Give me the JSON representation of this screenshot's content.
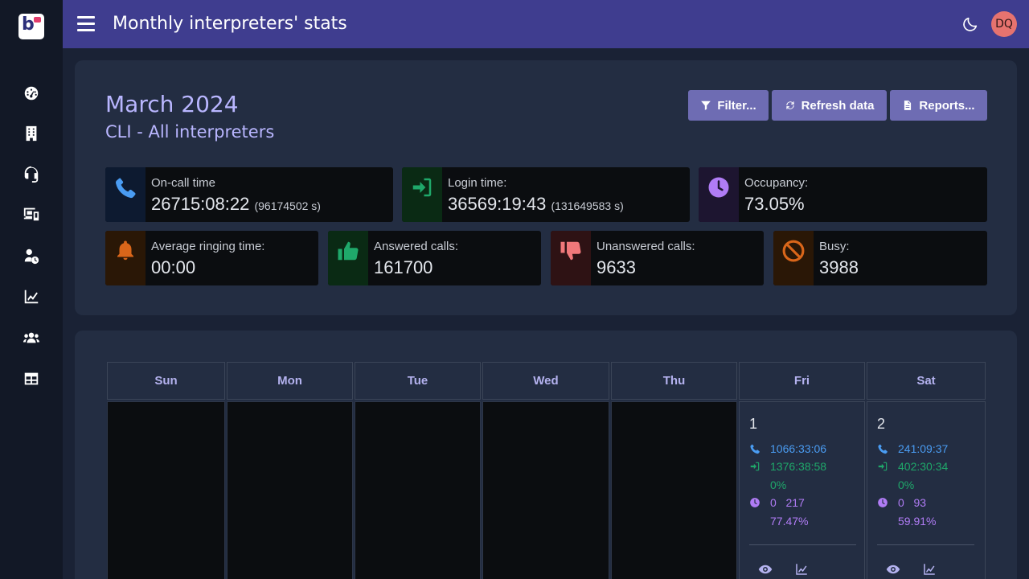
{
  "header": {
    "title": "Monthly interpreters' stats",
    "avatar": "DQ"
  },
  "sidebar": {
    "items": [
      {
        "icon": "dashboard-gauge-icon"
      },
      {
        "icon": "building-icon"
      },
      {
        "icon": "headset-icon"
      },
      {
        "icon": "devices-icon"
      },
      {
        "icon": "user-clock-icon"
      },
      {
        "icon": "line-chart-icon"
      },
      {
        "icon": "users-icon"
      },
      {
        "icon": "table-icon"
      }
    ]
  },
  "summary": {
    "month": "March 2024",
    "subtitle": "CLI - All interpreters",
    "buttons": {
      "filter": "Filter...",
      "refresh": "Refresh data",
      "reports": "Reports..."
    },
    "stats": {
      "oncall": {
        "label": "On-call time",
        "value": "26715:08:22",
        "detail": "(96174502 s)"
      },
      "login": {
        "label": "Login time:",
        "value": "36569:19:43",
        "detail": "(131649583 s)"
      },
      "occupancy": {
        "label": "Occupancy:",
        "value": "73.05%"
      },
      "ringing": {
        "label": "Average ringing time:",
        "value": "00:00"
      },
      "answered": {
        "label": "Answered calls:",
        "value": "161700"
      },
      "unanswered": {
        "label": "Unanswered calls:",
        "value": "9633"
      },
      "busy": {
        "label": "Busy:",
        "value": "3988"
      }
    }
  },
  "calendar": {
    "days": [
      "Sun",
      "Mon",
      "Tue",
      "Wed",
      "Thu",
      "Fri",
      "Sat"
    ],
    "cells": [
      {
        "day": "1",
        "oncall": "1066:33:06",
        "login": "1376:38:58",
        "login_pct": "0%",
        "occ_a": "0",
        "occ_b": "217",
        "occ_pct": "77.47%"
      },
      {
        "day": "2",
        "oncall": "241:09:37",
        "login": "402:30:34",
        "login_pct": "0%",
        "occ_a": "0",
        "occ_b": "93",
        "occ_pct": "59.91%"
      }
    ]
  },
  "colors": {
    "header": "#3f3d8f",
    "sidebar": "#121826",
    "card": "#232d42",
    "button": "#6e6cb3",
    "accent_text": "#b9b6ff",
    "blue": "#4a9cf2",
    "green": "#1fa86a",
    "purple": "#b07cf5",
    "orange": "#d9661a",
    "red": "#f0787a"
  }
}
